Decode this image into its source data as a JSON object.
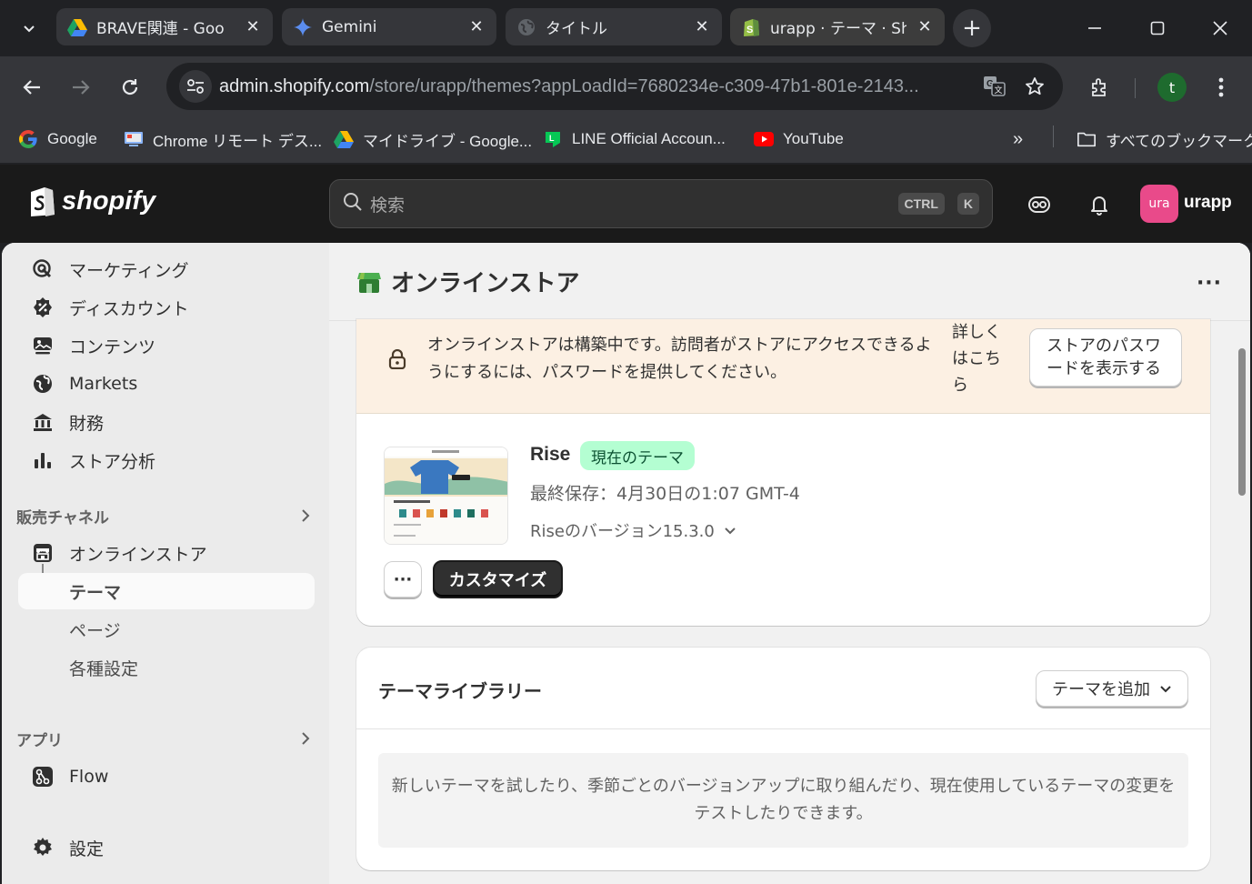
{
  "browser": {
    "tabs": [
      {
        "title": "BRAVE関連 - Goo",
        "icon": "google-drive-icon"
      },
      {
        "title": "Gemini",
        "icon": "gemini-icon"
      },
      {
        "title": "タイトル",
        "icon": "globe-icon"
      },
      {
        "title": "urapp · テーマ · Sho",
        "icon": "shopify-icon",
        "active": true
      }
    ],
    "url_host": "admin.shopify.com",
    "url_path": "/store/urapp/themes?appLoadId=7680234e-c309-47b1-801e-2143...",
    "profile_initial": "t",
    "bookmarks": [
      {
        "label": "Google",
        "icon": "google-icon"
      },
      {
        "label": "Chrome リモート デス...",
        "icon": "chrome-remote-icon"
      },
      {
        "label": "マイドライブ - Google...",
        "icon": "google-drive-icon"
      },
      {
        "label": "LINE Official Accoun...",
        "icon": "line-icon"
      },
      {
        "label": "YouTube",
        "icon": "youtube-icon"
      }
    ],
    "all_bookmarks": "すべてのブックマーク"
  },
  "shopify": {
    "logo_text": "shopify",
    "search_placeholder": "検索",
    "kbd_ctrl": "CTRL",
    "kbd_k": "K",
    "store_avatar": "ura",
    "store_name": "urapp"
  },
  "sidebar": {
    "items": [
      {
        "label": "マーケティング",
        "icon": "marketing-icon"
      },
      {
        "label": "ディスカウント",
        "icon": "discount-icon"
      },
      {
        "label": "コンテンツ",
        "icon": "content-icon"
      },
      {
        "label": "Markets",
        "icon": "globe-markets-icon"
      },
      {
        "label": "財務",
        "icon": "finance-icon"
      },
      {
        "label": "ストア分析",
        "icon": "analytics-icon"
      }
    ],
    "sales_channels_title": "販売チャネル",
    "online_store": "オンラインストア",
    "sub_items": [
      "テーマ",
      "ページ",
      "各種設定"
    ],
    "apps_title": "アプリ",
    "flow": "Flow",
    "settings": "設定"
  },
  "page": {
    "title": "オンラインストア",
    "banner_text": "オンラインストアは構築中です。訪問者がストアにアクセスできるようにするには、パスワードを提供してください。",
    "banner_link": "詳しくはこちら",
    "banner_button": "ストアのパスワードを表示する",
    "theme_name": "Rise",
    "current_badge": "現在のテーマ",
    "last_saved": "最終保存：4月30日の1:07 GMT-4",
    "version": "Riseのバージョン15.3.0",
    "customize_button": "カスタマイズ",
    "library_title": "テーマライブラリー",
    "add_theme_button": "テーマを追加",
    "library_empty_text": "新しいテーマを試したり、季節ごとのバージョンアップに取り組んだり、現在使用しているテーマの変更をテストしたりできます。"
  },
  "colors": {
    "chrome_dark": "#202124",
    "chrome_toolbar": "#35363a",
    "shopify_header": "#1a1a1a",
    "banner_bg": "#fcf0e3",
    "badge_bg": "#b4fed2",
    "badge_text": "#0c5132",
    "avatar_pink": "#e94a8a"
  }
}
